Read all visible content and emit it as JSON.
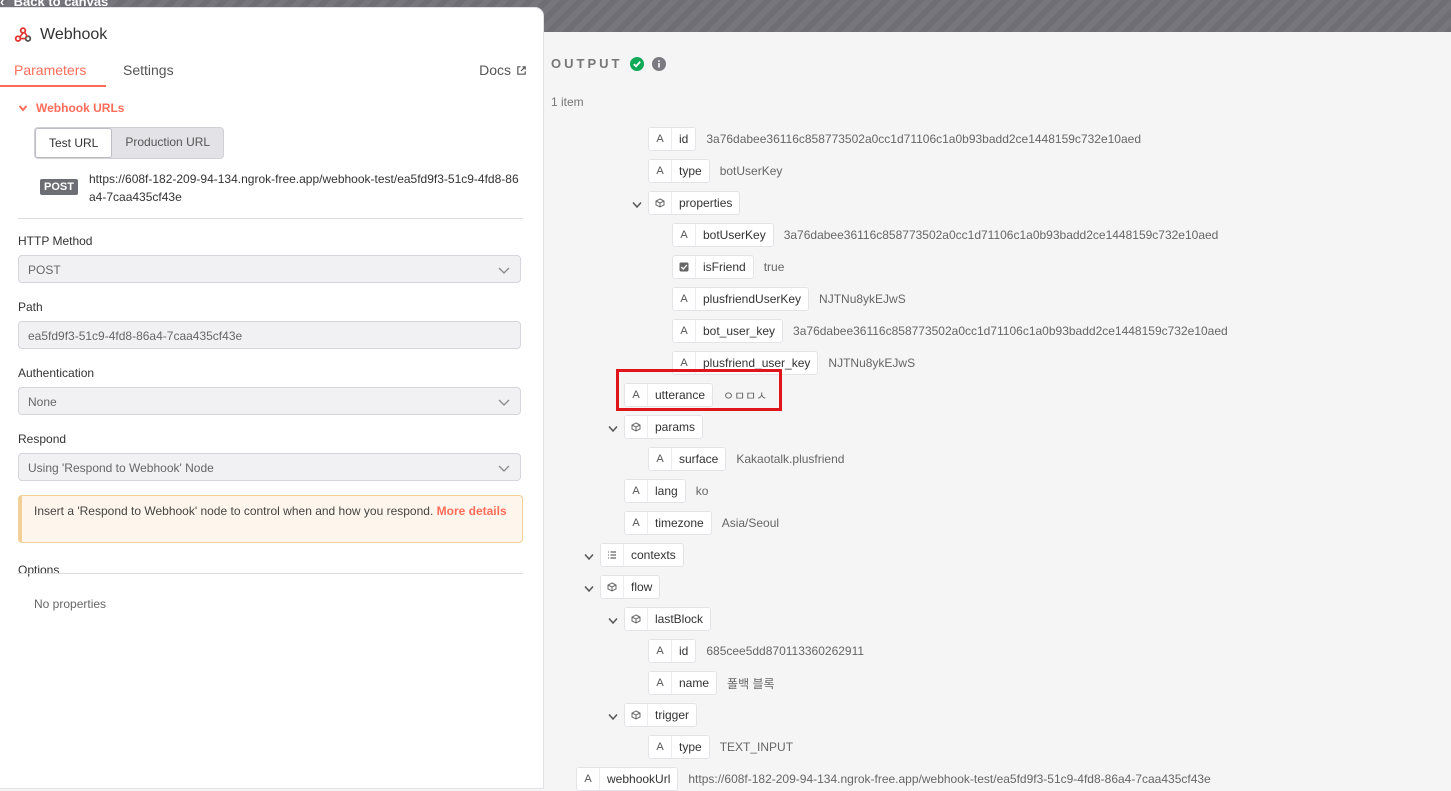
{
  "header": {
    "back_label": "Back to canvas"
  },
  "node": {
    "title": "Webhook"
  },
  "tabs": [
    {
      "label": "Parameters"
    },
    {
      "label": "Settings"
    }
  ],
  "docs_label": "Docs",
  "webhook_urls": {
    "section_label": "Webhook URLs",
    "toggle": [
      {
        "label": "Test URL"
      },
      {
        "label": "Production URL"
      }
    ],
    "method_badge": "POST",
    "url": "https://608f-182-209-94-134.ngrok-free.app/webhook-test/ea5fd9f3-51c9-4fd8-86a4-7caa435cf43e"
  },
  "fields": {
    "http_method": {
      "label": "HTTP Method",
      "value": "POST"
    },
    "path": {
      "label": "Path",
      "value": "ea5fd9f3-51c9-4fd8-86a4-7caa435cf43e"
    },
    "authentication": {
      "label": "Authentication",
      "value": "None"
    },
    "respond": {
      "label": "Respond",
      "value": "Using 'Respond to Webhook' Node"
    }
  },
  "notice": {
    "text": "Insert a 'Respond to Webhook' node to control when and how you respond. ",
    "link": "More details"
  },
  "options": {
    "label": "Options",
    "empty": "No properties"
  },
  "output": {
    "title": "OUTPUT",
    "count": "1 item",
    "rows": [
      {
        "key": "id",
        "type": "string",
        "value": "3a76dabee36116c858773502a0cc1d71106c1a0b93badd2ce1448159c732e10aed"
      },
      {
        "key": "type",
        "type": "string",
        "value": "botUserKey"
      },
      {
        "key": "properties",
        "type": "object",
        "value": ""
      },
      {
        "key": "botUserKey",
        "type": "string",
        "value": "3a76dabee36116c858773502a0cc1d71106c1a0b93badd2ce1448159c732e10aed"
      },
      {
        "key": "isFriend",
        "type": "boolean",
        "value": "true"
      },
      {
        "key": "plusfriendUserKey",
        "type": "string",
        "value": "NJTNu8ykEJwS"
      },
      {
        "key": "bot_user_key",
        "type": "string",
        "value": "3a76dabee36116c858773502a0cc1d71106c1a0b93badd2ce1448159c732e10aed"
      },
      {
        "key": "plusfriend_user_key",
        "type": "string",
        "value": "NJTNu8ykEJwS"
      },
      {
        "key": "utterance",
        "type": "string",
        "value": "ㅇㅁㅁㅅ"
      },
      {
        "key": "params",
        "type": "object",
        "value": ""
      },
      {
        "key": "surface",
        "type": "string",
        "value": "Kakaotalk.plusfriend"
      },
      {
        "key": "lang",
        "type": "string",
        "value": "ko"
      },
      {
        "key": "timezone",
        "type": "string",
        "value": "Asia/Seoul"
      },
      {
        "key": "contexts",
        "type": "array",
        "value": ""
      },
      {
        "key": "flow",
        "type": "object",
        "value": ""
      },
      {
        "key": "lastBlock",
        "type": "object",
        "value": ""
      },
      {
        "key": "id",
        "type": "string",
        "value": "685cee5dd870113360262911"
      },
      {
        "key": "name",
        "type": "string",
        "value": "폴백 블록"
      },
      {
        "key": "trigger",
        "type": "object",
        "value": ""
      },
      {
        "key": "type",
        "type": "string",
        "value": "TEXT_INPUT"
      },
      {
        "key": "webhookUrl",
        "type": "string",
        "value": "https://608f-182-209-94-134.ngrok-free.app/webhook-test/ea5fd9f3-51c9-4fd8-86a4-7caa435cf43e"
      }
    ]
  },
  "colors": {
    "accent": "#ff6d5a",
    "success": "#0fa958",
    "highlight": "#e0151b"
  }
}
